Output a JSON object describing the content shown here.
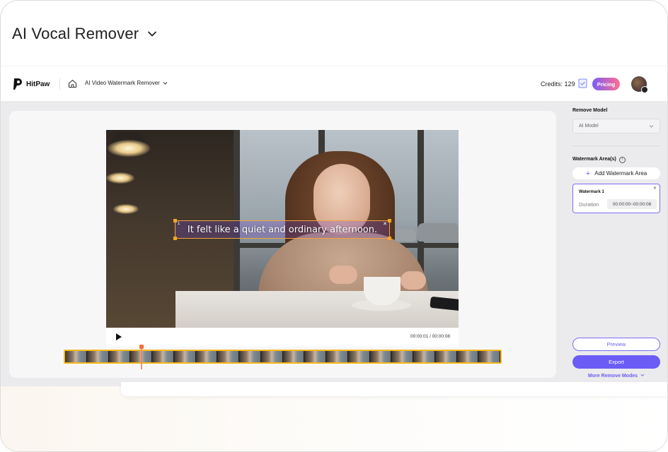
{
  "page": {
    "title": "AI Vocal Remover"
  },
  "header": {
    "brand": "HitPaw",
    "tool_selector": "AI Video Watermark Remover",
    "credits_label": "Credits: 129",
    "pricing_label": "Pricing"
  },
  "video": {
    "watermark_text": "It felt like a quiet and ordinary afternoon.",
    "watermark_index": "1",
    "timecode": "00:00:01 / 00:00:08"
  },
  "timeline": {
    "frame_count": 20
  },
  "panel": {
    "remove_model_label": "Remove Model",
    "model_value": "AI Model",
    "watermark_areas_label": "Watermark Area(s)",
    "add_area_label": "Add Watermark Area",
    "area_card": {
      "title": "Watermark 1",
      "duration_label": "Duration",
      "duration_value": "00:00:00~00:00:08"
    },
    "preview_label": "Preview",
    "export_label": "Export",
    "more_modes_label": "More Remove Modes"
  },
  "colors": {
    "accent": "#6b5cf5",
    "timeline_border": "#f5b91a",
    "watermark_handle": "#f5a623",
    "playhead": "#f76b35"
  },
  "icons": [
    "chevron-down-icon",
    "hitpaw-logo-icon",
    "home-icon",
    "credits-icon",
    "play-icon",
    "info-icon",
    "plus-icon",
    "close-icon"
  ]
}
